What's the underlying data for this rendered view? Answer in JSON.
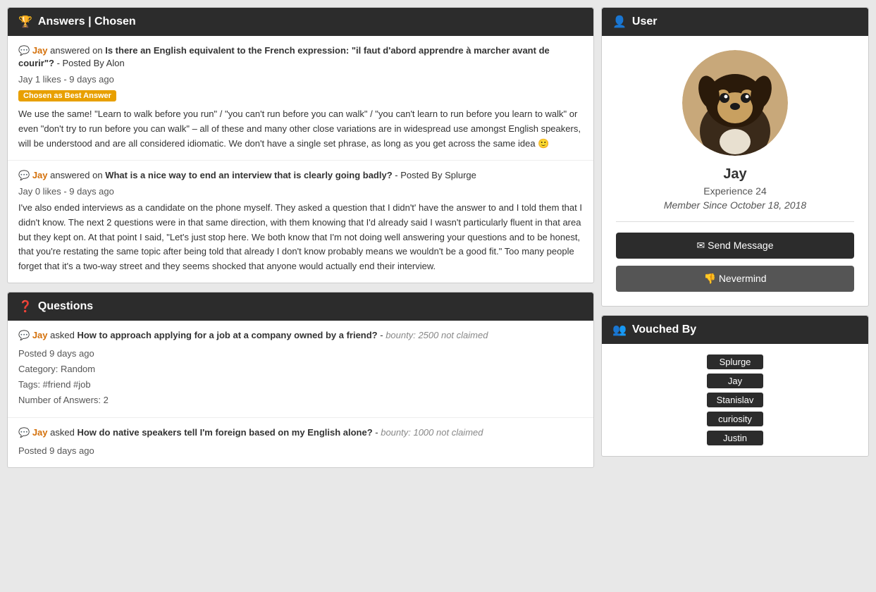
{
  "page": {
    "answers_section": {
      "header": {
        "icon": "🏆",
        "title": "Answers | Chosen"
      },
      "items": [
        {
          "user": "Jay",
          "action": "answered on",
          "question": "Is there an English equivalent to the French expression: \"il faut d'abord apprendre à marcher avant de courir\"?",
          "posted_by": "Posted By Alon",
          "likes": "Jay 1 likes",
          "time_ago": "9 days ago",
          "badge": "Chosen as Best Answer",
          "body": "We use the same! \"Learn to walk before you run\" / \"you can't run before you can walk\" / \"you can't learn to run before you learn to walk\" or even \"don't try to run before you can walk\" – all of these and many other close variations are in widespread use amongst English speakers, will be understood and are all considered idiomatic. We don't have a single set phrase, as long as you get across the same idea 🙂"
        },
        {
          "user": "Jay",
          "action": "answered on",
          "question": "What is a nice way to end an interview that is clearly going badly?",
          "posted_by": "Posted By Splurge",
          "likes": "Jay 0 likes",
          "time_ago": "9 days ago",
          "badge": null,
          "body": "I've also ended interviews as a candidate on the phone myself. They asked a question that I didn't' have the answer to and I told them that I didn't know. The next 2 questions were in that same direction, with them knowing that I'd already said I wasn't particularly fluent in that area but they kept on. At that point I said, \"Let's just stop here. We both know that I'm not doing well answering your questions and to be honest, that you're restating the same topic after being told that already I don't know probably means we wouldn't be a good fit.\" Too many people forget that it's a two-way street and they seems shocked that anyone would actually end their interview."
        }
      ]
    },
    "questions_section": {
      "header": {
        "icon": "❓",
        "title": "Questions"
      },
      "items": [
        {
          "user": "Jay",
          "action": "asked",
          "question": "How to approach applying for a job at a company owned by a friend?",
          "bounty": "bounty: 2500 not claimed",
          "posted": "Posted 9 days ago",
          "category": "Category: Random",
          "tags": "Tags: #friend #job",
          "num_answers": "Number of Answers: 2"
        },
        {
          "user": "Jay",
          "action": "asked",
          "question": "How do native speakers tell I'm foreign based on my English alone?",
          "bounty": "bounty: 1000 not claimed",
          "posted": "Posted 9 days ago",
          "category": null,
          "tags": null,
          "num_answers": null
        }
      ]
    },
    "user_panel": {
      "header": {
        "icon": "👤",
        "title": "User"
      },
      "name": "Jay",
      "experience_label": "Experience",
      "experience_value": "24",
      "member_since_label": "Member Since",
      "member_since_date": "October 18, 2018",
      "send_message_btn": "Send Message",
      "nevermind_btn": "Nevermind"
    },
    "vouched_panel": {
      "header": {
        "icon": "👥",
        "title": "Vouched By"
      },
      "vouchers": [
        "Splurge",
        "Jay",
        "Stanislav",
        "curiosity",
        "Justin"
      ]
    }
  }
}
